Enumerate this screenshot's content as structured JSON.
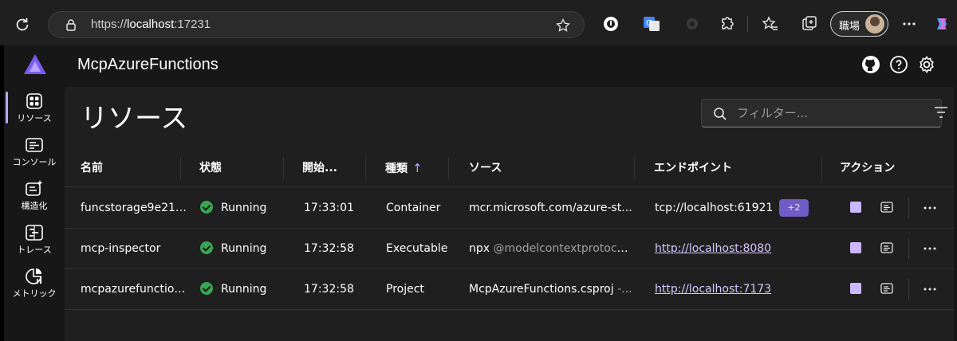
{
  "browser": {
    "url_scheme": "https://",
    "url_host": "localhost",
    "url_port": ":17231",
    "profile_name": "職場"
  },
  "app": {
    "title": "McpAzureFunctions",
    "accent": "#b9a5ff"
  },
  "nav": {
    "items": [
      {
        "label": "リソース",
        "icon": "grid-icon"
      },
      {
        "label": "コンソール",
        "icon": "console-icon"
      },
      {
        "label": "構造化",
        "icon": "structured-log-icon"
      },
      {
        "label": "トレース",
        "icon": "traces-icon"
      },
      {
        "label": "メトリック",
        "icon": "metrics-icon"
      }
    ]
  },
  "page": {
    "title": "リソース",
    "filter_placeholder": "フィルター..."
  },
  "table": {
    "headers": {
      "name": "名前",
      "state": "状態",
      "start": "開始...",
      "type": "種類",
      "source": "ソース",
      "endpoint": "エンドポイント",
      "actions": "アクション"
    },
    "sort_indicator": "↑",
    "rows": [
      {
        "name": "funcstorage9e217...",
        "state": "Running",
        "start": "17:33:01",
        "type": "Container",
        "source": "mcr.microsoft.com/azure-st...",
        "source_extra": "",
        "endpoint": "tcp://localhost:61921",
        "endpoint_badge": "+2"
      },
      {
        "name": "mcp-inspector",
        "state": "Running",
        "start": "17:32:58",
        "type": "Executable",
        "source": "npx",
        "source_extra": "@modelcontextprotoco...",
        "endpoint": "http://localhost:8080",
        "endpoint_badge": ""
      },
      {
        "name": "mcpazurefunctions...",
        "state": "Running",
        "start": "17:32:58",
        "type": "Project",
        "source": "McpAzureFunctions.csproj",
        "source_extra": "-...",
        "endpoint": "http://localhost:7173",
        "endpoint_badge": ""
      }
    ]
  }
}
